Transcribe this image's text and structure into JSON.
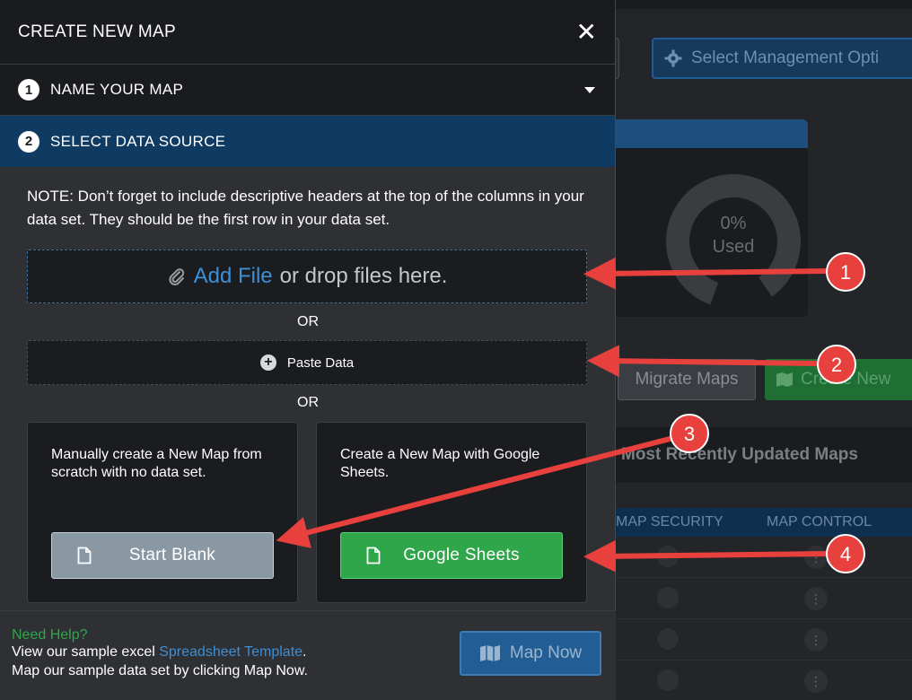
{
  "background": {
    "management_button_label": "Select Management Opti",
    "gauge_percent": "0%",
    "gauge_label": "Used",
    "migrate_button_label": "Migrate Maps",
    "create_button_label": "Create New",
    "recent_heading": "Most Recently Updated Maps",
    "table_headers": [
      "MAP SECURITY",
      "MAP CONTROL"
    ],
    "row_count": 4
  },
  "modal": {
    "title": "CREATE NEW MAP",
    "close_glyph": "✕",
    "steps": [
      {
        "number": "1",
        "label": "NAME YOUR MAP"
      },
      {
        "number": "2",
        "label": "SELECT DATA SOURCE"
      }
    ],
    "note": "NOTE: Don’t forget to include descriptive headers at the top of the columns in your data set. They should be the first row in your data set.",
    "dropzone": {
      "link_text": "Add File",
      "rest_text": "or drop files here."
    },
    "or_text": "OR",
    "paste_label": "Paste Data",
    "cards": {
      "blank": {
        "description": "Manually create a New Map from scratch with no data set.",
        "button_label": "Start Blank"
      },
      "sheets": {
        "description": "Create a New Map with Google Sheets.",
        "button_label": "Google Sheets"
      }
    },
    "footer": {
      "help_title": "Need Help?",
      "line1_prefix": "View our sample excel",
      "template_link": "Spreadsheet Template",
      "line1_suffix": ".",
      "line2": "Map our sample data set by clicking Map Now.",
      "map_now_label": "Map Now"
    }
  },
  "callouts": [
    "1",
    "2",
    "3",
    "4"
  ],
  "colors": {
    "accent_blue": "#3d8fd6",
    "step_active": "#0f3b63",
    "green": "#2fa64a",
    "callout_red": "#e8403d"
  }
}
